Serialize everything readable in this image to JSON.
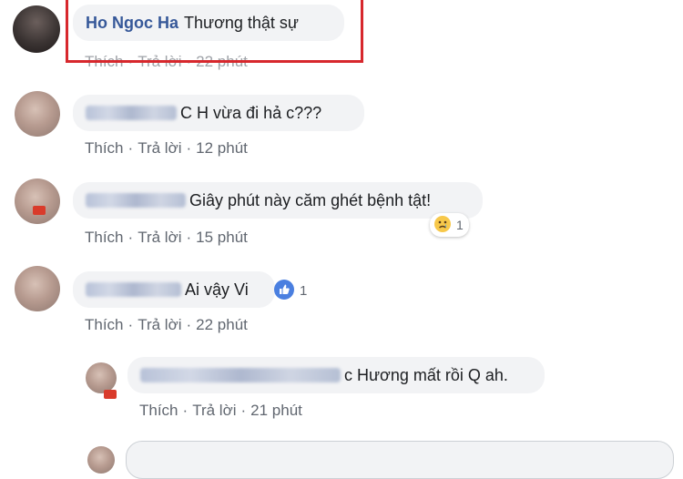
{
  "comments": [
    {
      "author": "Ho Ngoc Ha",
      "text": "Thương thật sự",
      "like": "Thích",
      "reply": "Trả lời",
      "time": "22 phút"
    },
    {
      "text": "C H vừa đi hả c???",
      "like": "Thích",
      "reply": "Trả lời",
      "time": "12 phút"
    },
    {
      "text": "Giây phút này căm ghét bệnh tật!",
      "like": "Thích",
      "reply": "Trả lời",
      "time": "15 phút",
      "reaction": {
        "icon": "sad-face-icon",
        "count": "1"
      }
    },
    {
      "text": "Ai vậy Vi",
      "like": "Thích",
      "reply": "Trả lời",
      "time": "22 phút",
      "reaction": {
        "icon": "thumbs-up-icon",
        "count": "1"
      }
    },
    {
      "text": "c Hương mất rồi Q ah.",
      "like": "Thích",
      "reply": "Trả lời",
      "time": "21 phút"
    }
  ],
  "colors": {
    "author": "#365899",
    "bubble": "#f2f3f5",
    "highlight": "#d7282d",
    "meta": "#616770"
  }
}
